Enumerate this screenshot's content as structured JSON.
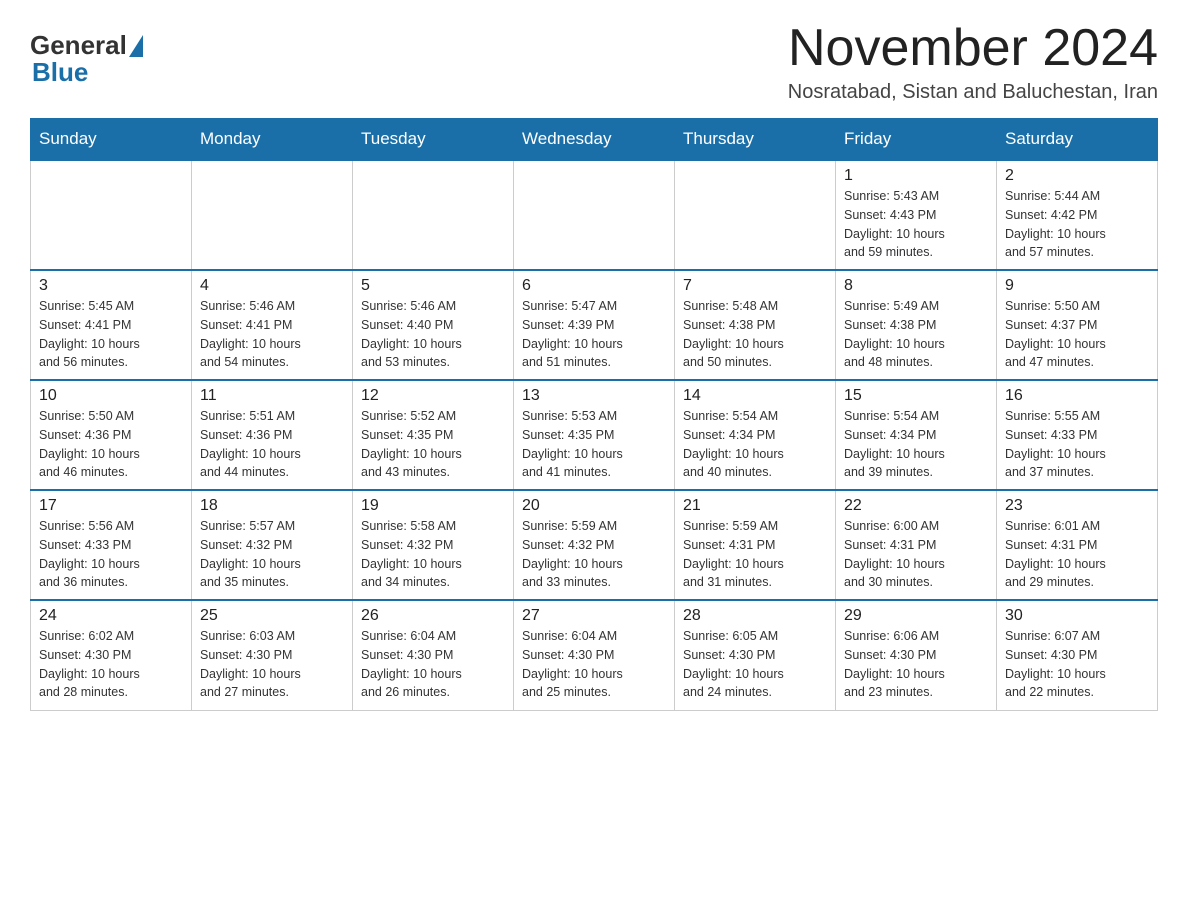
{
  "header": {
    "logo_general": "General",
    "logo_blue": "Blue",
    "month_title": "November 2024",
    "location": "Nosratabad, Sistan and Baluchestan, Iran"
  },
  "days_of_week": [
    "Sunday",
    "Monday",
    "Tuesday",
    "Wednesday",
    "Thursday",
    "Friday",
    "Saturday"
  ],
  "weeks": [
    [
      {
        "day": "",
        "info": ""
      },
      {
        "day": "",
        "info": ""
      },
      {
        "day": "",
        "info": ""
      },
      {
        "day": "",
        "info": ""
      },
      {
        "day": "",
        "info": ""
      },
      {
        "day": "1",
        "info": "Sunrise: 5:43 AM\nSunset: 4:43 PM\nDaylight: 10 hours\nand 59 minutes."
      },
      {
        "day": "2",
        "info": "Sunrise: 5:44 AM\nSunset: 4:42 PM\nDaylight: 10 hours\nand 57 minutes."
      }
    ],
    [
      {
        "day": "3",
        "info": "Sunrise: 5:45 AM\nSunset: 4:41 PM\nDaylight: 10 hours\nand 56 minutes."
      },
      {
        "day": "4",
        "info": "Sunrise: 5:46 AM\nSunset: 4:41 PM\nDaylight: 10 hours\nand 54 minutes."
      },
      {
        "day": "5",
        "info": "Sunrise: 5:46 AM\nSunset: 4:40 PM\nDaylight: 10 hours\nand 53 minutes."
      },
      {
        "day": "6",
        "info": "Sunrise: 5:47 AM\nSunset: 4:39 PM\nDaylight: 10 hours\nand 51 minutes."
      },
      {
        "day": "7",
        "info": "Sunrise: 5:48 AM\nSunset: 4:38 PM\nDaylight: 10 hours\nand 50 minutes."
      },
      {
        "day": "8",
        "info": "Sunrise: 5:49 AM\nSunset: 4:38 PM\nDaylight: 10 hours\nand 48 minutes."
      },
      {
        "day": "9",
        "info": "Sunrise: 5:50 AM\nSunset: 4:37 PM\nDaylight: 10 hours\nand 47 minutes."
      }
    ],
    [
      {
        "day": "10",
        "info": "Sunrise: 5:50 AM\nSunset: 4:36 PM\nDaylight: 10 hours\nand 46 minutes."
      },
      {
        "day": "11",
        "info": "Sunrise: 5:51 AM\nSunset: 4:36 PM\nDaylight: 10 hours\nand 44 minutes."
      },
      {
        "day": "12",
        "info": "Sunrise: 5:52 AM\nSunset: 4:35 PM\nDaylight: 10 hours\nand 43 minutes."
      },
      {
        "day": "13",
        "info": "Sunrise: 5:53 AM\nSunset: 4:35 PM\nDaylight: 10 hours\nand 41 minutes."
      },
      {
        "day": "14",
        "info": "Sunrise: 5:54 AM\nSunset: 4:34 PM\nDaylight: 10 hours\nand 40 minutes."
      },
      {
        "day": "15",
        "info": "Sunrise: 5:54 AM\nSunset: 4:34 PM\nDaylight: 10 hours\nand 39 minutes."
      },
      {
        "day": "16",
        "info": "Sunrise: 5:55 AM\nSunset: 4:33 PM\nDaylight: 10 hours\nand 37 minutes."
      }
    ],
    [
      {
        "day": "17",
        "info": "Sunrise: 5:56 AM\nSunset: 4:33 PM\nDaylight: 10 hours\nand 36 minutes."
      },
      {
        "day": "18",
        "info": "Sunrise: 5:57 AM\nSunset: 4:32 PM\nDaylight: 10 hours\nand 35 minutes."
      },
      {
        "day": "19",
        "info": "Sunrise: 5:58 AM\nSunset: 4:32 PM\nDaylight: 10 hours\nand 34 minutes."
      },
      {
        "day": "20",
        "info": "Sunrise: 5:59 AM\nSunset: 4:32 PM\nDaylight: 10 hours\nand 33 minutes."
      },
      {
        "day": "21",
        "info": "Sunrise: 5:59 AM\nSunset: 4:31 PM\nDaylight: 10 hours\nand 31 minutes."
      },
      {
        "day": "22",
        "info": "Sunrise: 6:00 AM\nSunset: 4:31 PM\nDaylight: 10 hours\nand 30 minutes."
      },
      {
        "day": "23",
        "info": "Sunrise: 6:01 AM\nSunset: 4:31 PM\nDaylight: 10 hours\nand 29 minutes."
      }
    ],
    [
      {
        "day": "24",
        "info": "Sunrise: 6:02 AM\nSunset: 4:30 PM\nDaylight: 10 hours\nand 28 minutes."
      },
      {
        "day": "25",
        "info": "Sunrise: 6:03 AM\nSunset: 4:30 PM\nDaylight: 10 hours\nand 27 minutes."
      },
      {
        "day": "26",
        "info": "Sunrise: 6:04 AM\nSunset: 4:30 PM\nDaylight: 10 hours\nand 26 minutes."
      },
      {
        "day": "27",
        "info": "Sunrise: 6:04 AM\nSunset: 4:30 PM\nDaylight: 10 hours\nand 25 minutes."
      },
      {
        "day": "28",
        "info": "Sunrise: 6:05 AM\nSunset: 4:30 PM\nDaylight: 10 hours\nand 24 minutes."
      },
      {
        "day": "29",
        "info": "Sunrise: 6:06 AM\nSunset: 4:30 PM\nDaylight: 10 hours\nand 23 minutes."
      },
      {
        "day": "30",
        "info": "Sunrise: 6:07 AM\nSunset: 4:30 PM\nDaylight: 10 hours\nand 22 minutes."
      }
    ]
  ]
}
